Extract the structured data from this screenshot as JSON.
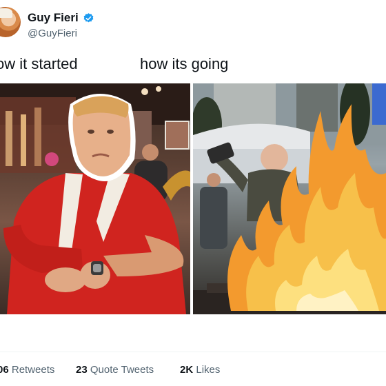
{
  "tweet": {
    "author_name": "Guy Fieri",
    "author_handle": "@GuyFieri",
    "caption_left": "ow it started",
    "caption_right": "how its going"
  },
  "stats": {
    "retweets_count": "06",
    "retweets_label": "Retweets",
    "quote_count": "23",
    "quote_label": "Quote Tweets",
    "likes_count": "2K",
    "likes_label": "Likes"
  },
  "colors": {
    "verified_blue": "#1d9bf0",
    "secondary_text": "#536471",
    "primary_text": "#0f1419",
    "shirt_red": "#d0241f",
    "flame_orange": "#f39a2e"
  },
  "icons": {
    "verified": "verified-badge-icon"
  }
}
